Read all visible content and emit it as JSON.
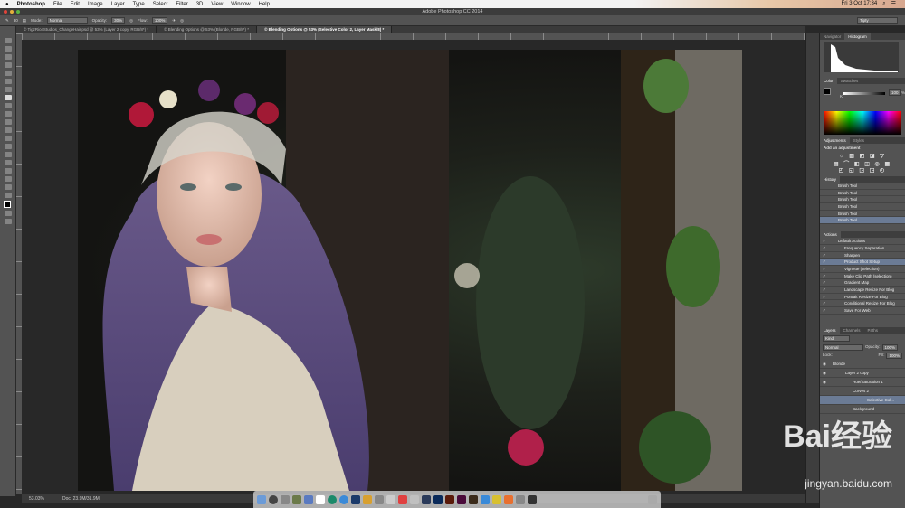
{
  "menubar": {
    "apple": "",
    "app": "Photoshop",
    "items": [
      "File",
      "Edit",
      "Image",
      "Layer",
      "Type",
      "Select",
      "Filter",
      "3D",
      "View",
      "Window",
      "Help"
    ],
    "clock": "Fri 3 Oct  17:34"
  },
  "window": {
    "title": "Adobe Photoshop CC 2014"
  },
  "options": {
    "brush_size": "80",
    "mode_label": "Mode:",
    "mode": "Normal",
    "opacity_label": "Opacity:",
    "opacity": "30%",
    "flow_label": "Flow:",
    "flow": "100%",
    "workspace": "Tipty"
  },
  "tabs": [
    {
      "label": "© TigzRiceStudios_ChangeHair.psd @ 53% (Layer 2 copy, RGB/8*) *"
    },
    {
      "label": "© Blending Options @ 53% (Blonde, RGB/8*) *"
    },
    {
      "label": "© Blending Options @ 53% (Selective Color 2, Layer Mask/8) *",
      "active": true
    }
  ],
  "status": {
    "zoom": "53.03%",
    "doc": "Doc: 23.9M/31.9M"
  },
  "panels": {
    "navigator_tabs": [
      "Navigator",
      "Histogram"
    ],
    "color_tabs": [
      "Color",
      "Swatches"
    ],
    "color_k_label": "K",
    "color_value": "100",
    "color_unit": "%",
    "adjustments_tabs": [
      "Adjustments",
      "Styles"
    ],
    "adjustments_title": "Add an adjustment",
    "history_title": "History",
    "history": [
      "Brush Tool",
      "Brush Tool",
      "Brush Tool",
      "Brush Tool",
      "Brush Tool",
      "Brush Tool"
    ],
    "actions_title": "Actions",
    "actions": [
      "Default Actions",
      "Frequency Separation",
      "Sharpen",
      "Product Shot Setup",
      "Vignette (selection)",
      "Make Clip Path (selection)",
      "Gradient Map",
      "Landscape Resize For Blog",
      "Portrait Resize For Blog",
      "Conditional Resize For Blog",
      "Save For Web"
    ],
    "layers_tabs": [
      "Layers",
      "Channels",
      "Paths"
    ],
    "layers_filter": "Kind",
    "layers_blend": "Normal",
    "opacity_label": "Opacity:",
    "opacity": "100%",
    "lock_label": "Lock:",
    "fill_label": "Fill:",
    "fill": "100%",
    "layers": [
      "Blonde",
      "Layer 2 copy",
      "Hue/Saturation 1",
      "Curves 2",
      "Selective Col...",
      "Background"
    ]
  },
  "watermark": {
    "logo": "Bai经验",
    "url": "jingyan.baidu.com"
  }
}
